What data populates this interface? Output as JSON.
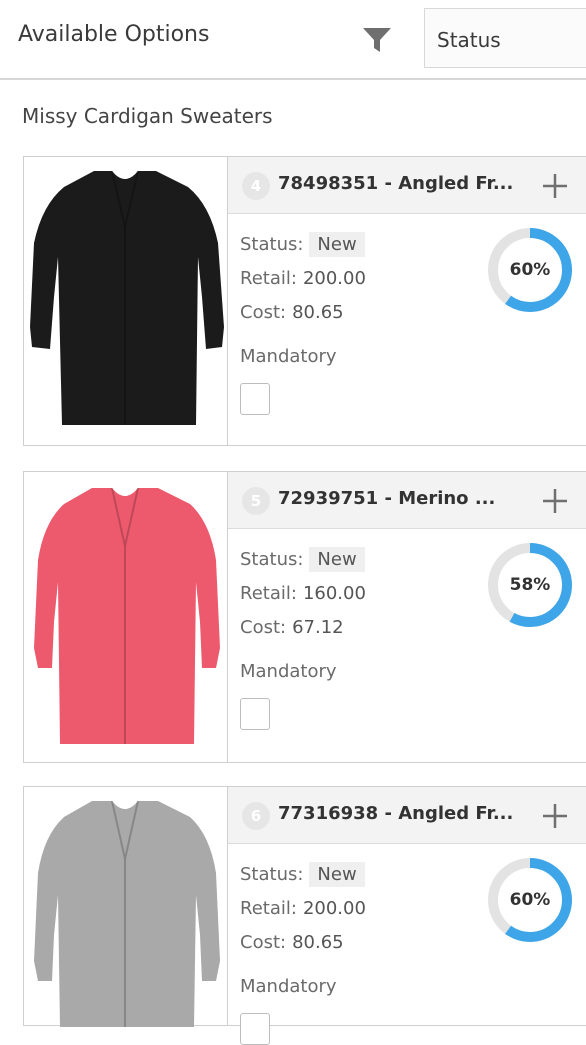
{
  "header": {
    "title": "Available Options",
    "filter_icon": "filter-icon",
    "status_select": "Status"
  },
  "section_title": "Missy Cardigan Sweaters",
  "labels": {
    "status": "Status:",
    "retail": "Retail:",
    "cost": "Cost:",
    "mandatory": "Mandatory"
  },
  "colors": {
    "accent": "#3ea6e8",
    "donut_track": "#e3e3e3",
    "sweater_black": "#1b1b1b",
    "sweater_pink": "#ee5a6d",
    "sweater_gray": "#a9a9a9"
  },
  "items": [
    {
      "rank": "4",
      "name": "78498351 - Angled Fr...",
      "status": "New",
      "retail": "200.00",
      "cost": "80.65",
      "percent_label": "60%",
      "percent": 0.6,
      "mandatory": false,
      "sweater_color": "#1b1b1b"
    },
    {
      "rank": "5",
      "name": "72939751 - Merino ...",
      "status": "New",
      "retail": "160.00",
      "cost": "67.12",
      "percent_label": "58%",
      "percent": 0.58,
      "mandatory": false,
      "sweater_color": "#ee5a6d"
    },
    {
      "rank": "6",
      "name": "77316938 - Angled Fr...",
      "status": "New",
      "retail": "200.00",
      "cost": "80.65",
      "percent_label": "60%",
      "percent": 0.6,
      "mandatory": false,
      "sweater_color": "#a9a9a9"
    }
  ]
}
